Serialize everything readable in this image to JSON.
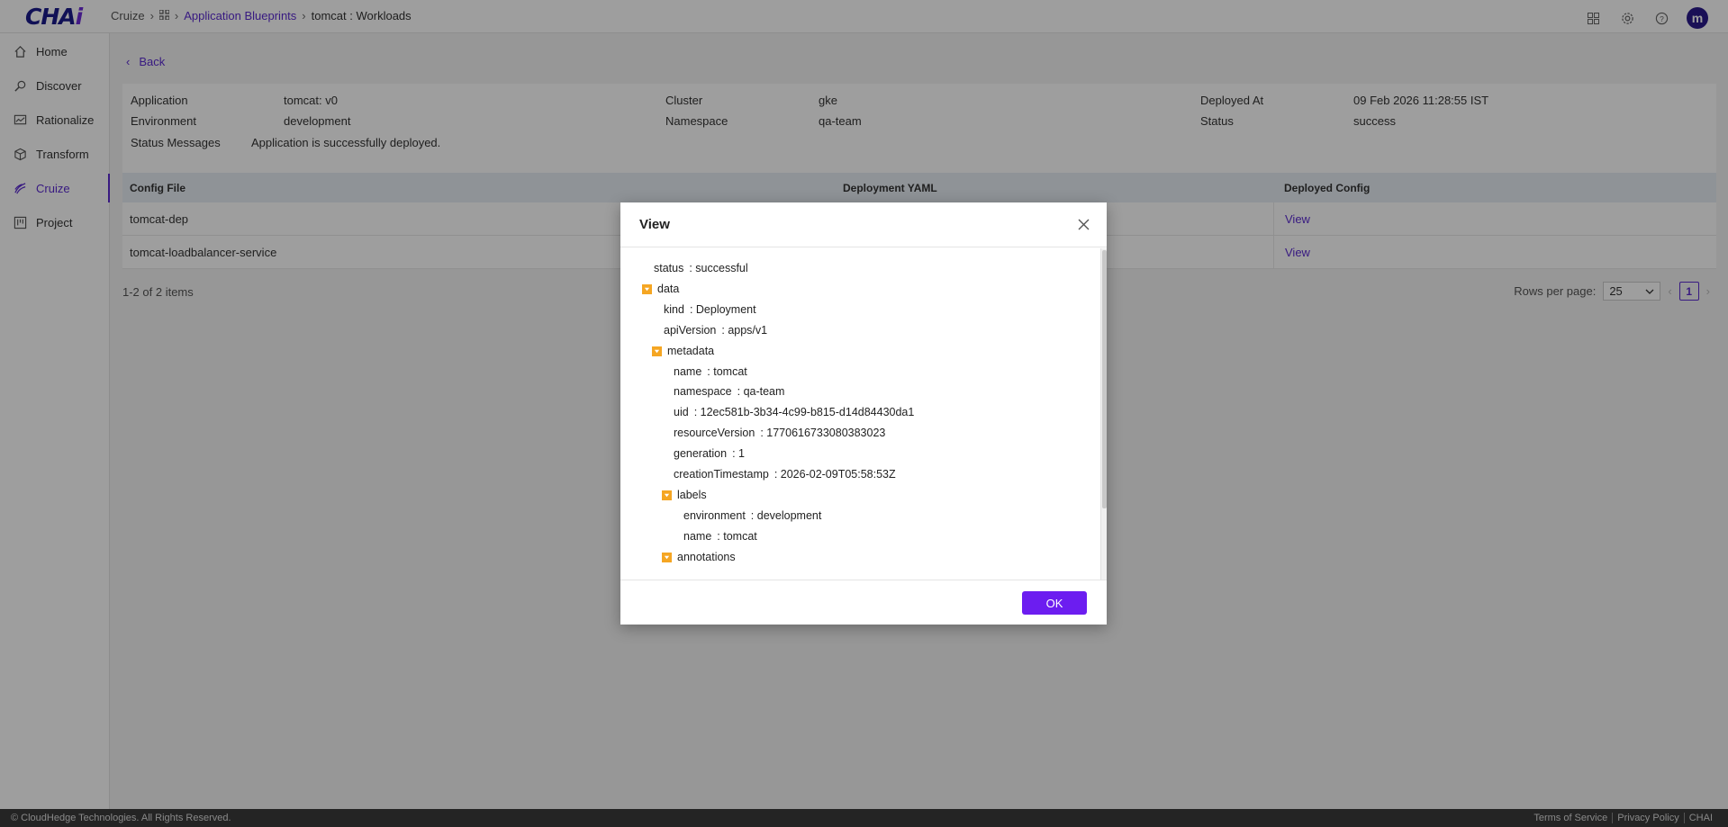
{
  "app": {
    "logo_main": "CHA",
    "logo_accent": "i"
  },
  "breadcrumb": {
    "root": "Cruize",
    "link": "Application Blueprints",
    "current": "tomcat : Workloads"
  },
  "sidebar": {
    "items": [
      {
        "label": "Home",
        "icon": "home-icon"
      },
      {
        "label": "Discover",
        "icon": "discover-icon"
      },
      {
        "label": "Rationalize",
        "icon": "rationalize-icon"
      },
      {
        "label": "Transform",
        "icon": "transform-icon"
      },
      {
        "label": "Cruize",
        "icon": "cruize-icon",
        "active": true
      },
      {
        "label": "Project",
        "icon": "project-icon"
      }
    ]
  },
  "user": {
    "initial": "m"
  },
  "main": {
    "back_label": "Back",
    "info": {
      "application_label": "Application",
      "application_value": "tomcat: v0",
      "environment_label": "Environment",
      "environment_value": "development",
      "status_messages_label": "Status Messages",
      "status_messages_value": "Application is successfully deployed.",
      "cluster_label": "Cluster",
      "cluster_value": "gke",
      "namespace_label": "Namespace",
      "namespace_value": "qa-team",
      "deployed_at_label": "Deployed At",
      "deployed_at_value": "09 Feb 2026 11:28:55 IST",
      "status_label": "Status",
      "status_value": "success"
    },
    "table": {
      "headers": [
        "Config File",
        "Deployment YAML",
        "Deployed Config"
      ],
      "rows": [
        {
          "config_file": "tomcat-dep",
          "deployed_config": "View"
        },
        {
          "config_file": "tomcat-loadbalancer-service",
          "deployed_config": "View"
        }
      ]
    },
    "pager": {
      "summary": "1-2 of 2 items",
      "rows_per_page_label": "Rows per page:",
      "rows_per_page_value": "25",
      "current_page": "1"
    }
  },
  "dialog": {
    "title": "View",
    "ok_label": "OK",
    "tree": [
      {
        "key": "status",
        "value": ": successful"
      },
      {
        "key": "data",
        "value": ""
      },
      {
        "key": "kind",
        "value": ": Deployment"
      },
      {
        "key": "apiVersion",
        "value": ": apps/v1"
      },
      {
        "key": "metadata",
        "value": ""
      },
      {
        "key": "name",
        "value": ": tomcat"
      },
      {
        "key": "namespace",
        "value": ": qa-team"
      },
      {
        "key": "uid",
        "value": ": 12ec581b-3b34-4c99-b815-d14d84430da1"
      },
      {
        "key": "resourceVersion",
        "value": ": 1770616733080383023"
      },
      {
        "key": "generation",
        "value": ": 1"
      },
      {
        "key": "creationTimestamp",
        "value": ": 2026-02-09T05:58:53Z"
      },
      {
        "key": "labels",
        "value": ""
      },
      {
        "key": "environment",
        "value": ": development"
      },
      {
        "key": "name",
        "value": ": tomcat"
      },
      {
        "key": "annotations",
        "value": ""
      }
    ]
  },
  "footer": {
    "copyright": "© CloudHedge Technologies. All Rights Reserved.",
    "terms": "Terms of Service",
    "privacy": "Privacy Policy",
    "brand": "CHAI"
  }
}
